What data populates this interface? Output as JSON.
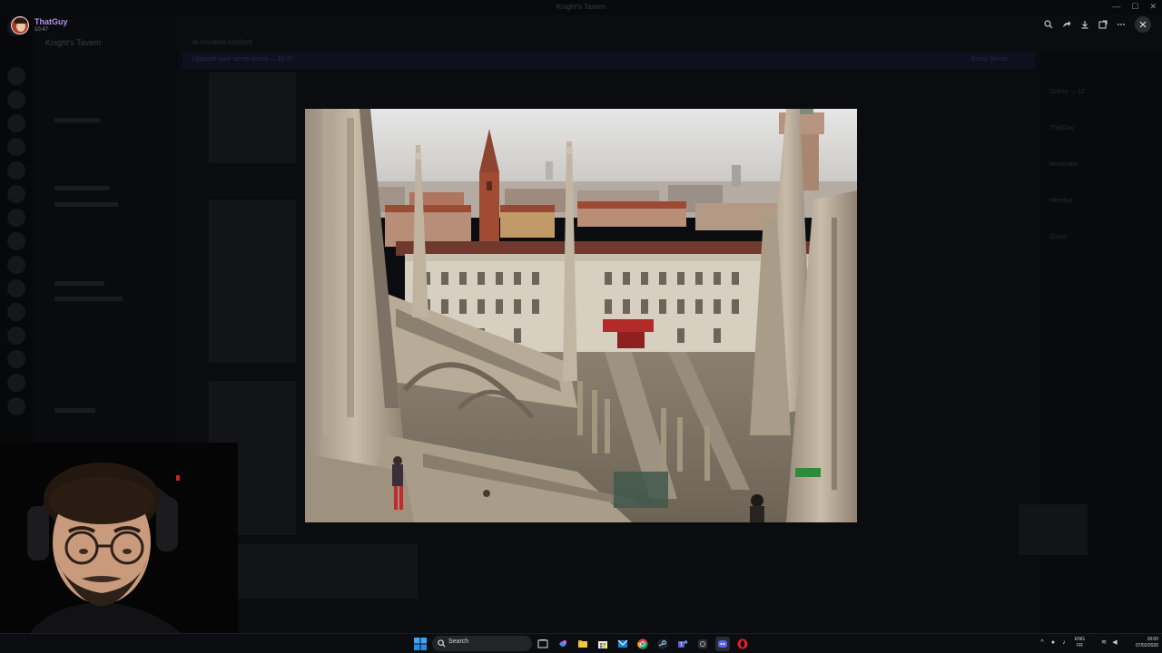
{
  "window": {
    "title": "Knight's Tavern",
    "controls": {
      "minimize": "—",
      "maximize": "☐",
      "close": "✕"
    }
  },
  "viewer": {
    "uploader": "ThatGuy",
    "time": "10:47",
    "image_alt": "View from the rooftop terraces of Milan Cathedral toward Palazzo Reale",
    "tools": [
      "zoom-icon",
      "forward-icon",
      "download-icon",
      "open-external-icon",
      "more-icon"
    ],
    "close": "✕"
  },
  "background": {
    "server_name": "Knight's Tavern",
    "chat_channel": "le-creative-content",
    "banner_text": "Upgrade your server boost — 10:47",
    "banner_button": "Boost Server",
    "members": [
      "Online — 12",
      "ThatGuy",
      "Moderator",
      "Member",
      "Guest"
    ]
  },
  "taskbar": {
    "search_label": "Search",
    "apps": [
      "task-view-icon",
      "copilot-icon",
      "file-explorer-icon",
      "store-icon",
      "mail-icon",
      "chrome-icon",
      "steam-icon",
      "teams-icon",
      "app-icon",
      "discord-icon",
      "opera-icon"
    ],
    "tray": {
      "language_line1": "ENG",
      "language_line2": "FR",
      "time": "18:00",
      "date": "07/02/2026"
    }
  },
  "colors": {
    "accent_purple": "#b590f0",
    "taskbar": "#0c0d10",
    "discord_blue": "#5865f2"
  }
}
